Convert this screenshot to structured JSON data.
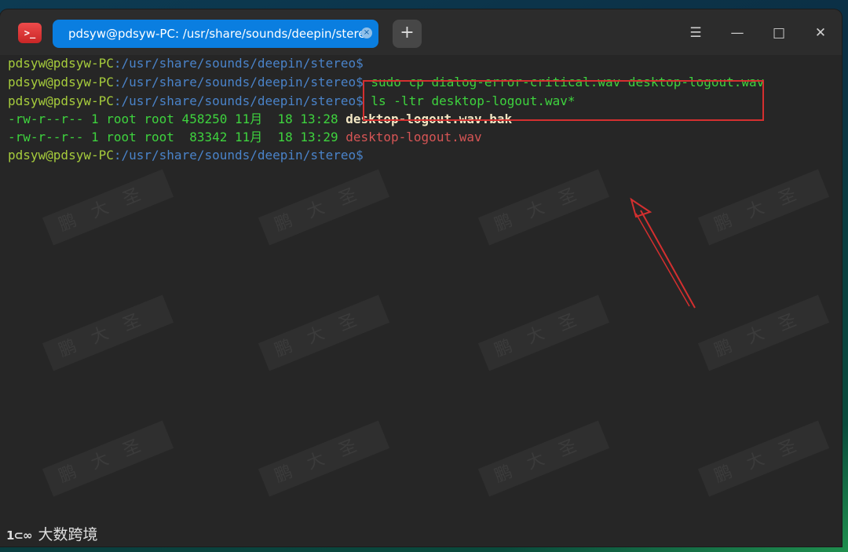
{
  "window": {
    "tab_title": "pdsyw@pdsyw-PC: /usr/share/sounds/deepin/stereo",
    "tab_close_glyph": "×",
    "new_tab_glyph": "+",
    "menu_glyph": "☰",
    "minimize_glyph": "—",
    "maximize_glyph": "□",
    "close_glyph": "✕"
  },
  "terminal": {
    "prompt_user": "pdsyw@pdsyw-PC",
    "prompt_sep": ":",
    "prompt_path": "/usr/share/sounds/deepin/stereo",
    "prompt_dollar": "$",
    "cmd1": " sudo cp dialog-error-critical.wav desktop-logout.wav",
    "cmd2": " ls -ltr desktop-logout.wav*",
    "file1": {
      "meta": "-rw-r--r-- 1 root root 458250 11月  18 13:28 ",
      "name": "desktop-logout.wav.bak"
    },
    "file2": {
      "meta": "-rw-r--r-- 1 root root  83342 11月  18 13:29 ",
      "name": "desktop-logout.wav"
    }
  },
  "watermark_text": "鹏大圣",
  "corner_logo": {
    "mark": "1⊂∞",
    "text": "大数跨境"
  },
  "colors": {
    "prompt_user": "#a6cc3c",
    "prompt_path": "#4a83c9",
    "command": "#3ed33e",
    "bak_file": "#f2e6c3",
    "wav_file": "#d65555",
    "annotation": "#d42f2f",
    "tab_active": "#0a7ee0"
  }
}
